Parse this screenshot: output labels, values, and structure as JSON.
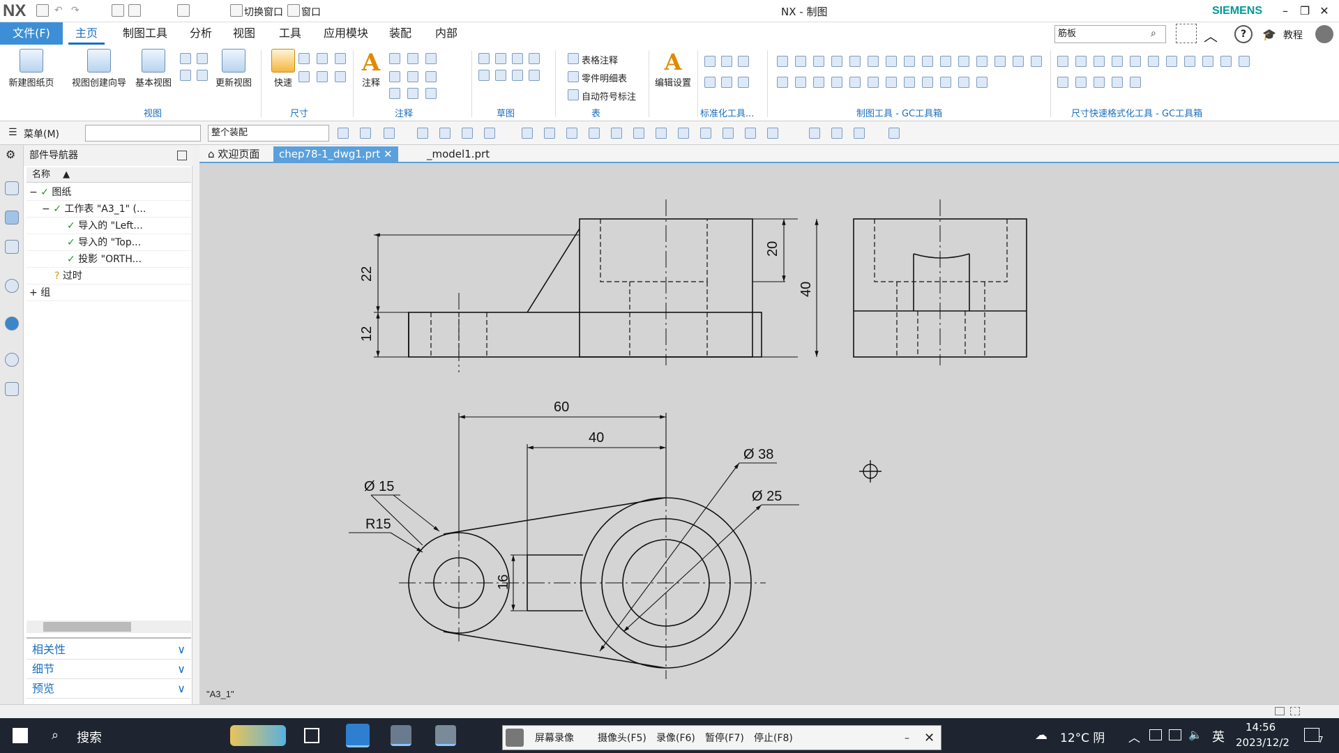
{
  "app": {
    "logo": "NX",
    "window_title": "NX - 制图",
    "brand": "SIEMENS"
  },
  "quick_access": {
    "switch_window": "切换窗口",
    "window": "窗口"
  },
  "menu_tabs": [
    "文件(F)",
    "主页",
    "制图工具",
    "分析",
    "视图",
    "工具",
    "应用模块",
    "装配",
    "内部"
  ],
  "search": {
    "value": "筋板",
    "tutorial": "教程"
  },
  "ribbon": {
    "big_buttons": [
      "新建图纸页",
      "视图创建向导",
      "基本视图",
      "更新视图",
      "快速",
      "注释",
      "编辑设置"
    ],
    "table_items": [
      "表格注释",
      "零件明细表",
      "自动符号标注"
    ],
    "groups": [
      "视图",
      "尺寸",
      "注释",
      "草图",
      "表",
      "标准化工具...",
      "制图工具 - GC工具箱",
      "尺寸快速格式化工具 - GC工具箱"
    ]
  },
  "toolbar2": {
    "menu": "菜单(M)",
    "filter_value": "",
    "assembly_scope": "整个装配"
  },
  "navigator": {
    "title": "部件导航器",
    "column_name": "名称",
    "tree": [
      {
        "expander": "−",
        "label": "图纸",
        "check": true
      },
      {
        "expander": "−",
        "label": "工作表 \"A3_1\" (...",
        "check": true
      },
      {
        "expander": "",
        "label": "导入的 \"Left...",
        "check": true
      },
      {
        "expander": "",
        "label": "导入的 \"Top...",
        "check": true
      },
      {
        "expander": "",
        "label": "投影 \"ORTH...",
        "check": true
      },
      {
        "expander": "",
        "label": "过时",
        "check": false
      },
      {
        "expander": "+",
        "label": "组",
        "check": false
      }
    ],
    "panels": [
      "相关性",
      "细节",
      "预览"
    ]
  },
  "doc_tabs": [
    "欢迎页面",
    "chep78-1_dwg1.prt",
    "_model1.prt"
  ],
  "drawing": {
    "sheet_label": "\"A3_1\"",
    "dims": {
      "d22": "22",
      "d12": "12",
      "d20": "20",
      "d40v": "40",
      "d60": "60",
      "d40h": "40",
      "dia15": "Ø 15",
      "r15": "R15",
      "dia38": "Ø 38",
      "dia25": "Ø 25",
      "d16": "16"
    }
  },
  "taskbar": {
    "search": "搜索",
    "recorder": [
      "屏幕录像",
      "摄像头(F5)",
      "录像(F6)",
      "暂停(F7)",
      "停止(F8)"
    ],
    "weather": "12°C 阴",
    "ime": "英",
    "time": "14:56",
    "date": "2023/12/2",
    "notifications": "7"
  },
  "colors": {
    "accent": "#1a6fc0",
    "file_tab": "#3c8fd6",
    "brand": "#009999",
    "canvas": "#d4d4d4"
  }
}
